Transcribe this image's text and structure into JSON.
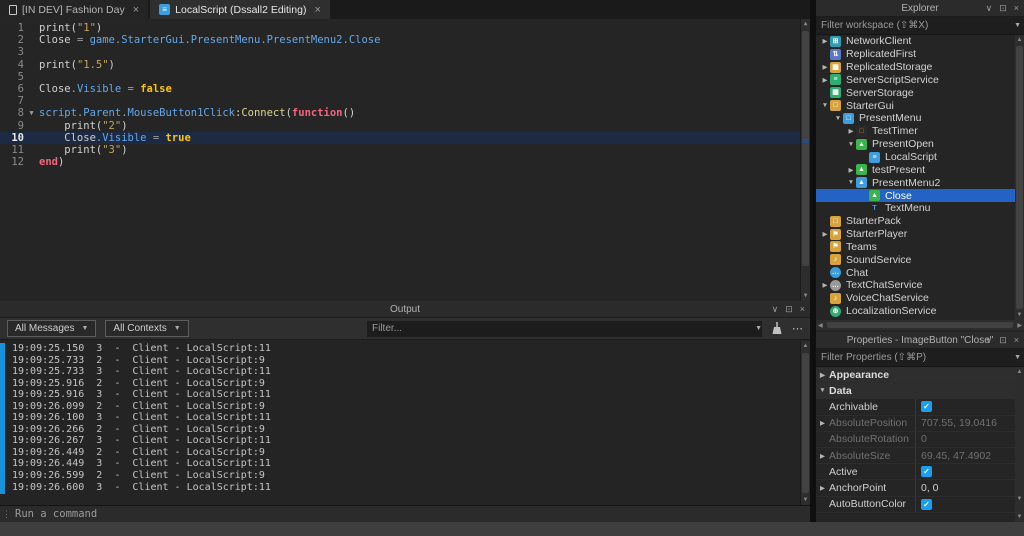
{
  "colors": {
    "selection": "#2263c5",
    "checkbox": "#18a0f0",
    "line_highlight": "#1c2a44",
    "keyword_gold": "#ffc600",
    "keyword_pink": "#f4647c",
    "builtin_blue": "#64a7e8",
    "string_gold": "#c9a455",
    "output_marker_blue": "#1791d8"
  },
  "tabs": {
    "items": [
      {
        "label": "[IN DEV] Fashion Day",
        "icon": "place-file-icon",
        "close": "×",
        "active": false
      },
      {
        "label": "LocalScript (Dssall2 Editing)",
        "icon": "script-icon",
        "close": "×",
        "active": true
      }
    ]
  },
  "editor": {
    "lines": [
      {
        "n": "1",
        "tokens": [
          [
            "plain",
            "print("
          ],
          [
            "str",
            "\"1\""
          ],
          [
            "plain",
            ")"
          ]
        ]
      },
      {
        "n": "2",
        "tokens": [
          [
            "plain",
            "Close "
          ],
          [
            "op",
            "="
          ],
          [
            "plain",
            " "
          ],
          [
            "blue",
            "game"
          ],
          [
            "op",
            "."
          ],
          [
            "blue",
            "StarterGui"
          ],
          [
            "op",
            "."
          ],
          [
            "blue",
            "PresentMenu"
          ],
          [
            "op",
            "."
          ],
          [
            "blue",
            "PresentMenu2"
          ],
          [
            "op",
            "."
          ],
          [
            "blue",
            "Close"
          ]
        ]
      },
      {
        "n": "3",
        "tokens": []
      },
      {
        "n": "4",
        "tokens": [
          [
            "plain",
            "print("
          ],
          [
            "str",
            "\"1.5\""
          ],
          [
            "plain",
            ")"
          ]
        ]
      },
      {
        "n": "5",
        "tokens": []
      },
      {
        "n": "6",
        "tokens": [
          [
            "plain",
            "Close"
          ],
          [
            "op",
            "."
          ],
          [
            "blue",
            "Visible"
          ],
          [
            "plain",
            " "
          ],
          [
            "op",
            "="
          ],
          [
            "plain",
            " "
          ],
          [
            "kw",
            "false"
          ]
        ]
      },
      {
        "n": "7",
        "tokens": []
      },
      {
        "n": "8",
        "fold": true,
        "tokens": [
          [
            "blue",
            "script"
          ],
          [
            "op",
            "."
          ],
          [
            "blue",
            "Parent"
          ],
          [
            "op",
            "."
          ],
          [
            "blue",
            "MouseButton1Click"
          ],
          [
            "plain",
            ":"
          ],
          [
            "method",
            "Connect"
          ],
          [
            "plain",
            "("
          ],
          [
            "pink",
            "function"
          ],
          [
            "plain",
            "()"
          ]
        ]
      },
      {
        "n": "9",
        "tokens": [
          [
            "plain",
            "    print("
          ],
          [
            "str",
            "\"2\""
          ],
          [
            "plain",
            ")"
          ]
        ]
      },
      {
        "n": "10",
        "highlight": true,
        "tokens": [
          [
            "plain",
            "    Close"
          ],
          [
            "op",
            "."
          ],
          [
            "blue",
            "Visible"
          ],
          [
            "plain",
            " "
          ],
          [
            "op",
            "="
          ],
          [
            "plain",
            " "
          ],
          [
            "kw",
            "true"
          ]
        ]
      },
      {
        "n": "11",
        "tokens": [
          [
            "plain",
            "    print("
          ],
          [
            "str",
            "\"3\""
          ],
          [
            "plain",
            ")"
          ]
        ]
      },
      {
        "n": "12",
        "tokens": [
          [
            "pink",
            "end"
          ],
          [
            "plain",
            ")"
          ]
        ]
      }
    ]
  },
  "output": {
    "title": "Output",
    "messages_filter": "All Messages",
    "contexts_filter": "All Contexts",
    "filter_placeholder": "Filter...",
    "logs": [
      {
        "time": "19:09:25.150",
        "msg": "3",
        "src": "Client - LocalScript:11"
      },
      {
        "time": "19:09:25.733",
        "msg": "2",
        "src": "Client - LocalScript:9"
      },
      {
        "time": "19:09:25.733",
        "msg": "3",
        "src": "Client - LocalScript:11"
      },
      {
        "time": "19:09:25.916",
        "msg": "2",
        "src": "Client - LocalScript:9"
      },
      {
        "time": "19:09:25.916",
        "msg": "3",
        "src": "Client - LocalScript:11"
      },
      {
        "time": "19:09:26.099",
        "msg": "2",
        "src": "Client - LocalScript:9"
      },
      {
        "time": "19:09:26.100",
        "msg": "3",
        "src": "Client - LocalScript:11"
      },
      {
        "time": "19:09:26.266",
        "msg": "2",
        "src": "Client - LocalScript:9"
      },
      {
        "time": "19:09:26.267",
        "msg": "3",
        "src": "Client - LocalScript:11"
      },
      {
        "time": "19:09:26.449",
        "msg": "2",
        "src": "Client - LocalScript:9"
      },
      {
        "time": "19:09:26.449",
        "msg": "3",
        "src": "Client - LocalScript:11"
      },
      {
        "time": "19:09:26.599",
        "msg": "2",
        "src": "Client - LocalScript:9"
      },
      {
        "time": "19:09:26.600",
        "msg": "3",
        "src": "Client - LocalScript:11"
      }
    ]
  },
  "command_bar": {
    "placeholder": "Run a command"
  },
  "explorer": {
    "title": "Explorer",
    "filter_placeholder": "Filter workspace (⇧⌘X)",
    "items": [
      {
        "label": "NetworkClient",
        "level": 0,
        "expander": "right",
        "icon": "network-client-icon"
      },
      {
        "label": "ReplicatedFirst",
        "level": 0,
        "icon": "replicated-first-icon"
      },
      {
        "label": "ReplicatedStorage",
        "level": 0,
        "expander": "right",
        "icon": "replicated-storage-icon"
      },
      {
        "label": "ServerScriptService",
        "level": 0,
        "expander": "right",
        "icon": "server-script-service-icon"
      },
      {
        "label": "ServerStorage",
        "level": 0,
        "icon": "server-storage-icon"
      },
      {
        "label": "StarterGui",
        "level": 0,
        "expander": "down",
        "icon": "starter-gui-icon"
      },
      {
        "label": "PresentMenu",
        "level": 1,
        "expander": "down",
        "icon": "screen-gui-icon"
      },
      {
        "label": "TestTimer",
        "level": 2,
        "expander": "right",
        "icon": "frame-icon"
      },
      {
        "label": "PresentOpen",
        "level": 2,
        "expander": "down",
        "icon": "image-button-green-icon"
      },
      {
        "label": "LocalScript",
        "level": 3,
        "icon": "local-script-icon"
      },
      {
        "label": "testPresent",
        "level": 2,
        "expander": "right",
        "icon": "image-button-green-icon"
      },
      {
        "label": "PresentMenu2",
        "level": 2,
        "expander": "down",
        "icon": "image-label-blue-icon"
      },
      {
        "label": "Close",
        "level": 3,
        "icon": "image-button-green-icon",
        "selected": true
      },
      {
        "label": "TextMenu",
        "level": 3,
        "icon": "text-label-icon"
      },
      {
        "label": "StarterPack",
        "level": 0,
        "icon": "starter-pack-icon"
      },
      {
        "label": "StarterPlayer",
        "level": 0,
        "expander": "right",
        "icon": "starter-player-icon"
      },
      {
        "label": "Teams",
        "level": 0,
        "icon": "teams-icon"
      },
      {
        "label": "SoundService",
        "level": 0,
        "icon": "sound-service-icon"
      },
      {
        "label": "Chat",
        "level": 0,
        "icon": "chat-icon"
      },
      {
        "label": "TextChatService",
        "level": 0,
        "expander": "right",
        "icon": "text-chat-service-icon"
      },
      {
        "label": "VoiceChatService",
        "level": 0,
        "icon": "voice-chat-service-icon"
      },
      {
        "label": "LocalizationService",
        "level": 0,
        "icon": "localization-service-icon"
      }
    ]
  },
  "properties": {
    "title": "Properties - ImageButton \"Close\"",
    "filter_placeholder": "Filter Properties (⇧⌘P)",
    "rows": [
      {
        "type": "section",
        "label": "Appearance",
        "expander": "right"
      },
      {
        "type": "section",
        "label": "Data",
        "expander": "down"
      },
      {
        "type": "check",
        "label": "Archivable",
        "checked": true
      },
      {
        "type": "text",
        "label": "AbsolutePosition",
        "value": "707.55, 19.0416",
        "grayed": true,
        "expander": "right"
      },
      {
        "type": "text",
        "label": "AbsoluteRotation",
        "value": "0",
        "grayed": true
      },
      {
        "type": "text",
        "label": "AbsoluteSize",
        "value": "69.45, 47.4902",
        "grayed": true,
        "expander": "right"
      },
      {
        "type": "check",
        "label": "Active",
        "checked": true
      },
      {
        "type": "text",
        "label": "AnchorPoint",
        "value": "0, 0",
        "expander": "right"
      },
      {
        "type": "check",
        "label": "AutoButtonColor",
        "checked": true
      }
    ]
  },
  "chrome": {
    "dock_icon": "∨",
    "popout_icon": "⊡",
    "close_icon": "×"
  }
}
